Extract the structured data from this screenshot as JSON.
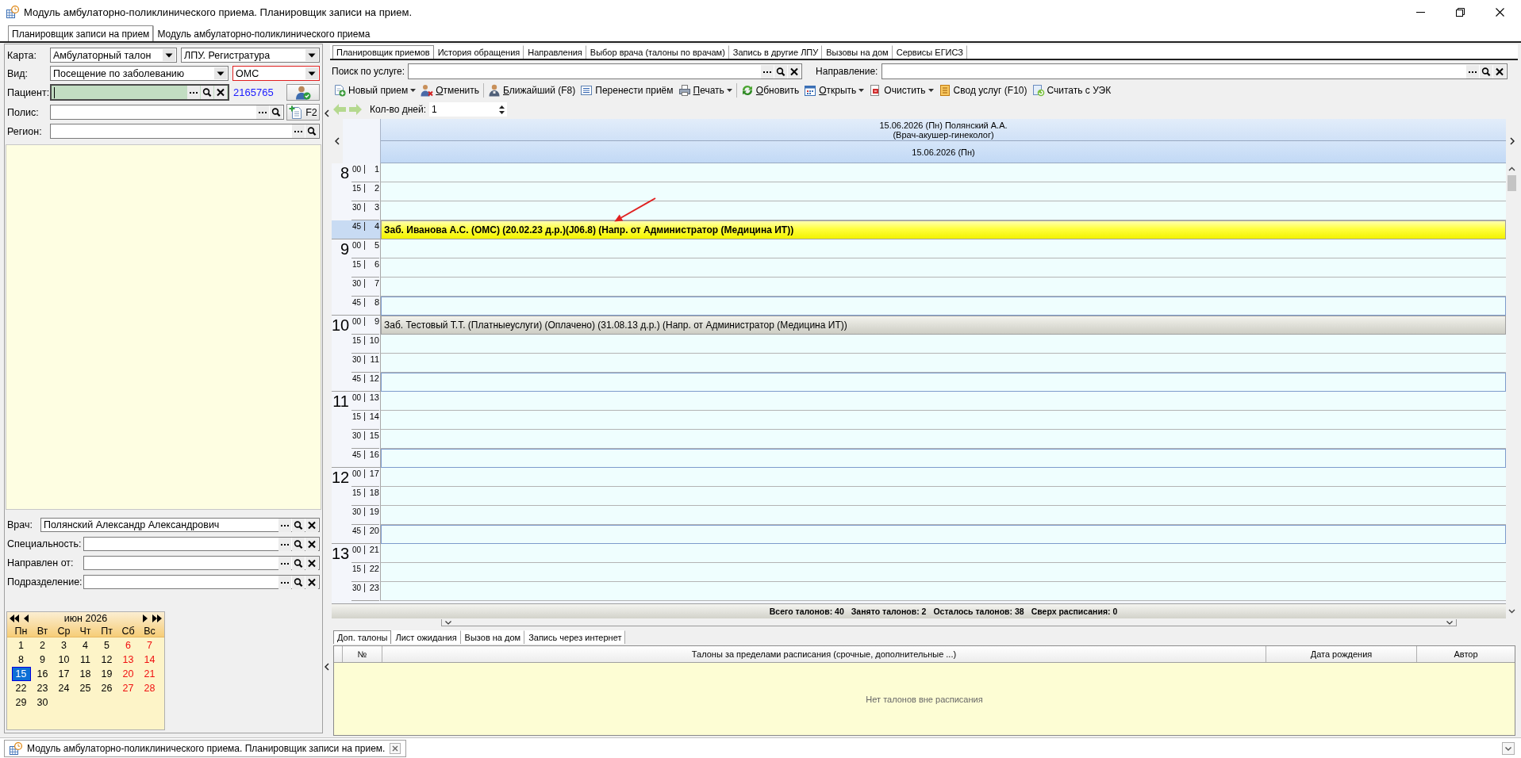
{
  "window": {
    "title": "Модуль амбулаторно-поликлинического приема. Планировщик записи на прием."
  },
  "module_tabs": [
    {
      "label": "Планировщик записи на прием",
      "selected": true
    },
    {
      "label": "Модуль амбулаторно-поликлинического приема",
      "selected": false
    }
  ],
  "card": {
    "label": "Карта:",
    "combos": [
      {
        "value": "Амбулаторный талон",
        "invalid": false
      },
      {
        "value": "ЛПУ. Регистратура",
        "invalid": false
      }
    ]
  },
  "visit": {
    "label": "Вид:",
    "combos": [
      {
        "value": "Посещение по заболеванию",
        "invalid": false
      },
      {
        "value": "ОМС",
        "invalid": true
      }
    ]
  },
  "patient": {
    "label": "Пациент:",
    "focused": true,
    "buttons": [
      {
        "kind": "browse"
      },
      {
        "kind": "search"
      },
      {
        "kind": "clear"
      }
    ],
    "number": "2165765"
  },
  "policy": {
    "label": "Полис:",
    "buttons": [
      {
        "kind": "browse"
      },
      {
        "kind": "search"
      }
    ],
    "key_button": "F2"
  },
  "region": {
    "label": "Регион:",
    "buttons": [
      {
        "kind": "browse"
      },
      {
        "kind": "search"
      }
    ]
  },
  "referral_fields": [
    {
      "label": "Врач:",
      "value": "Полянский Александр Александрович",
      "buttons": [
        {
          "kind": "browse"
        },
        {
          "kind": "search"
        },
        {
          "kind": "clear"
        }
      ]
    },
    {
      "label": "Специальность:",
      "buttons": [
        {
          "kind": "browse"
        },
        {
          "kind": "search"
        },
        {
          "kind": "clear"
        }
      ]
    },
    {
      "label": "Направлен от:",
      "buttons": [
        {
          "kind": "browse"
        },
        {
          "kind": "search"
        },
        {
          "kind": "clear"
        }
      ]
    },
    {
      "label": "Подразделение:",
      "buttons": [
        {
          "kind": "browse"
        },
        {
          "kind": "search"
        },
        {
          "kind": "clear"
        }
      ]
    }
  ],
  "calendar": {
    "month": "июн 2026",
    "weekdays": [
      "Пн",
      "Вт",
      "Ср",
      "Чт",
      "Пт",
      "Сб",
      "Вс"
    ],
    "weeks": [
      [
        {
          "day": "1",
          "weekend": false,
          "selected": false
        },
        {
          "day": "2",
          "weekend": false,
          "selected": false
        },
        {
          "day": "3",
          "weekend": false,
          "selected": false
        },
        {
          "day": "4",
          "weekend": false,
          "selected": false
        },
        {
          "day": "5",
          "weekend": false,
          "selected": false
        },
        {
          "day": "6",
          "weekend": true,
          "selected": false
        },
        {
          "day": "7",
          "weekend": true,
          "selected": false
        }
      ],
      [
        {
          "day": "8",
          "weekend": false,
          "selected": false
        },
        {
          "day": "9",
          "weekend": false,
          "selected": false
        },
        {
          "day": "10",
          "weekend": false,
          "selected": false
        },
        {
          "day": "11",
          "weekend": false,
          "selected": false
        },
        {
          "day": "12",
          "weekend": false,
          "selected": false
        },
        {
          "day": "13",
          "weekend": true,
          "selected": false
        },
        {
          "day": "14",
          "weekend": true,
          "selected": false
        }
      ],
      [
        {
          "day": "15",
          "weekend": false,
          "selected": true
        },
        {
          "day": "16",
          "weekend": false,
          "selected": false
        },
        {
          "day": "17",
          "weekend": false,
          "selected": false
        },
        {
          "day": "18",
          "weekend": false,
          "selected": false
        },
        {
          "day": "19",
          "weekend": false,
          "selected": false
        },
        {
          "day": "20",
          "weekend": true,
          "selected": false
        },
        {
          "day": "21",
          "weekend": true,
          "selected": false
        }
      ],
      [
        {
          "day": "22",
          "weekend": false,
          "selected": false
        },
        {
          "day": "23",
          "weekend": false,
          "selected": false
        },
        {
          "day": "24",
          "weekend": false,
          "selected": false
        },
        {
          "day": "25",
          "weekend": false,
          "selected": false
        },
        {
          "day": "26",
          "weekend": false,
          "selected": false
        },
        {
          "day": "27",
          "weekend": true,
          "selected": false
        },
        {
          "day": "28",
          "weekend": true,
          "selected": false
        }
      ],
      [
        {
          "day": "29",
          "weekend": false,
          "selected": false
        },
        {
          "day": "30",
          "weekend": false,
          "selected": false
        }
      ]
    ]
  },
  "tabs": [
    {
      "label": "Планировщик приемов",
      "selected": true
    },
    {
      "label": "История обращения",
      "selected": false
    },
    {
      "label": "Направления",
      "selected": false
    },
    {
      "label": "Выбор врача (талоны по врачам)",
      "selected": false
    },
    {
      "label": "Запись в другие ЛПУ",
      "selected": false
    },
    {
      "label": "Вызовы на дом",
      "selected": false
    },
    {
      "label": "Сервисы ЕГИСЗ",
      "selected": false
    }
  ],
  "search_fields": [
    {
      "label": "Поиск по услуге:",
      "buttons": [
        {
          "kind": "browse"
        },
        {
          "kind": "search"
        },
        {
          "kind": "clear"
        }
      ]
    },
    {
      "label": "Направление:",
      "buttons": [
        {
          "kind": "browse"
        },
        {
          "kind": "search"
        },
        {
          "kind": "clear"
        }
      ]
    }
  ],
  "toolbar": [
    [
      {
        "kind": "new",
        "label": "Новый прием",
        "dropdown": true,
        "mnemonic": false
      },
      {
        "kind": "cancel",
        "label": "Отменить",
        "dropdown": false,
        "mnemonic": true
      }
    ],
    [
      {
        "kind": "nearest",
        "label": "Ближайший (F8)",
        "dropdown": false,
        "mnemonic": true
      },
      {
        "kind": "transfer",
        "label": "Перенести приём",
        "dropdown": false,
        "mnemonic": false
      },
      {
        "kind": "print",
        "label": "Печать",
        "dropdown": true,
        "mnemonic": true
      }
    ],
    [
      {
        "kind": "refresh",
        "label": "Обновить",
        "dropdown": false,
        "mnemonic": true
      },
      {
        "kind": "open",
        "label": "Открыть",
        "dropdown": true,
        "mnemonic": true
      },
      {
        "kind": "clear",
        "label": "Очистить",
        "dropdown": true,
        "mnemonic": false
      },
      {
        "kind": "summary",
        "label": "Свод услуг (F10)",
        "dropdown": false,
        "mnemonic": false
      },
      {
        "kind": "card",
        "label": "Считать с УЭК",
        "dropdown": false,
        "mnemonic": false
      }
    ]
  ],
  "days": {
    "label": "Кол-во дней:",
    "value": "1"
  },
  "schedule": {
    "doctor": "15.06.2026 (Пн) Полянский А.А.",
    "specialty": "(Врач-акушер-гинеколог)",
    "date": "15.06.2026 (Пн)",
    "hours": [
      {
        "hour": "8",
        "slots": [
          {
            "minute": "00",
            "number": "1",
            "selected": false
          },
          {
            "minute": "15",
            "number": "2",
            "selected": false
          },
          {
            "minute": "30",
            "number": "3",
            "selected": false
          },
          {
            "minute": "45",
            "number": "4",
            "selected": true,
            "appointment": "Заб. Иванова А.С. (ОМС) (20.02.23 д.р.)(J06.8) (Напр. от Администратор (Медицина ИТ))"
          }
        ]
      },
      {
        "hour": "9",
        "slots": [
          {
            "minute": "00",
            "number": "5",
            "selected": false
          },
          {
            "minute": "15",
            "number": "6",
            "selected": false
          },
          {
            "minute": "30",
            "number": "7",
            "selected": false
          },
          {
            "minute": "45",
            "number": "8",
            "selected": false
          }
        ]
      },
      {
        "hour": "10",
        "slots": [
          {
            "minute": "00",
            "number": "9",
            "selected": false,
            "appointment": "Заб. Тестовый Т.Т. (Платныеуслуги) (Оплачено) (31.08.13 д.р.) (Напр. от Администратор (Медицина ИТ))"
          },
          {
            "minute": "15",
            "number": "10",
            "selected": false
          },
          {
            "minute": "30",
            "number": "11",
            "selected": false
          },
          {
            "minute": "45",
            "number": "12",
            "selected": false
          }
        ]
      },
      {
        "hour": "11",
        "slots": [
          {
            "minute": "00",
            "number": "13",
            "selected": false
          },
          {
            "minute": "15",
            "number": "14",
            "selected": false
          },
          {
            "minute": "30",
            "number": "15",
            "selected": false
          },
          {
            "minute": "45",
            "number": "16",
            "selected": false
          }
        ]
      },
      {
        "hour": "12",
        "slots": [
          {
            "minute": "00",
            "number": "17",
            "selected": false
          },
          {
            "minute": "15",
            "number": "18",
            "selected": false
          },
          {
            "minute": "30",
            "number": "19",
            "selected": false
          },
          {
            "minute": "45",
            "number": "20",
            "selected": false
          }
        ]
      },
      {
        "hour": "13",
        "slots": [
          {
            "minute": "00",
            "number": "21",
            "selected": false
          },
          {
            "minute": "15",
            "number": "22",
            "selected": false
          },
          {
            "minute": "30",
            "number": "23",
            "selected": false
          }
        ]
      }
    ],
    "summary": [
      "Всего талонов: 40",
      "Занято талонов: 2",
      "Осталось талонов: 38",
      "Сверх расписания: 0"
    ]
  },
  "bottom_tabs": [
    {
      "label": "Доп. талоны",
      "selected": true
    },
    {
      "label": "Лист ожидания",
      "selected": false
    },
    {
      "label": "Вызов на дом",
      "selected": false
    },
    {
      "label": "Запись через интернет",
      "selected": false
    }
  ],
  "extra_table": {
    "columns": [
      "№",
      "Талоны за пределами расписания (срочные, дополнительные ...)",
      "Дата рождения",
      "Автор"
    ],
    "empty_message": "Нет талонов вне расписания"
  },
  "document_tab": {
    "label": "Модуль амбулаторно-поликлинического приема. Планировщик записи на прием."
  }
}
